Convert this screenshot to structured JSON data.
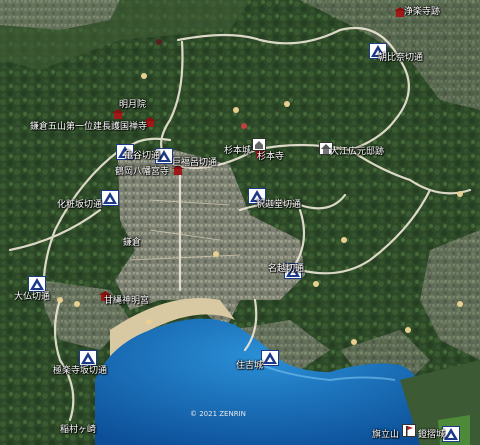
{
  "map": {
    "copyright": "© 2021 ZENRIN",
    "places": [
      {
        "id": "jorakuji",
        "label": "浄楽寺跡",
        "icon": "temple-icon"
      },
      {
        "id": "asaina",
        "label": "朝比奈切通",
        "icon": "pass-icon"
      },
      {
        "id": "meigetsuin",
        "label": "明月院",
        "icon": "temple-icon"
      },
      {
        "id": "kenchoji",
        "label": "鎌倉五山第一位建長護国禅寺",
        "icon": "temple-icon"
      },
      {
        "id": "kamegayatsu",
        "label": "亀谷切通",
        "icon": "pass-icon"
      },
      {
        "id": "kobukurozaka",
        "label": "巨福呂切通",
        "icon": "pass-icon"
      },
      {
        "id": "hachimangu",
        "label": "鶴岡八幡宮寺",
        "icon": "temple-icon"
      },
      {
        "id": "sugimoto",
        "label": "杉本城",
        "icon": "castle-icon"
      },
      {
        "id": "sugimotodera",
        "label": "杉本寺",
        "icon": "temple-icon"
      },
      {
        "id": "oehiromoto",
        "label": "大江広元邸跡",
        "icon": "house-icon"
      },
      {
        "id": "kewaizaka",
        "label": "化粧坂切通",
        "icon": "pass-icon"
      },
      {
        "id": "shakado",
        "label": "釈迦堂切通",
        "icon": "pass-icon"
      },
      {
        "id": "kamakura",
        "label": "鎌倉",
        "icon": ""
      },
      {
        "id": "nagoe",
        "label": "名越切通",
        "icon": "pass-icon"
      },
      {
        "id": "daibutsu",
        "label": "大仏切通",
        "icon": "pass-icon"
      },
      {
        "id": "amanawa",
        "label": "甘縄神明宮",
        "icon": "temple-icon"
      },
      {
        "id": "gokurakuji",
        "label": "極楽寺坂切通",
        "icon": "pass-icon"
      },
      {
        "id": "sumiyoshi",
        "label": "住吉城",
        "icon": "castle-icon"
      },
      {
        "id": "inamuragasaki",
        "label": "稲村ヶ崎",
        "icon": ""
      },
      {
        "id": "hatatateyama",
        "label": "旗立山",
        "icon": "flag-icon"
      },
      {
        "id": "nemokushi",
        "label": "鐙摺城",
        "icon": "castle-icon"
      }
    ]
  }
}
